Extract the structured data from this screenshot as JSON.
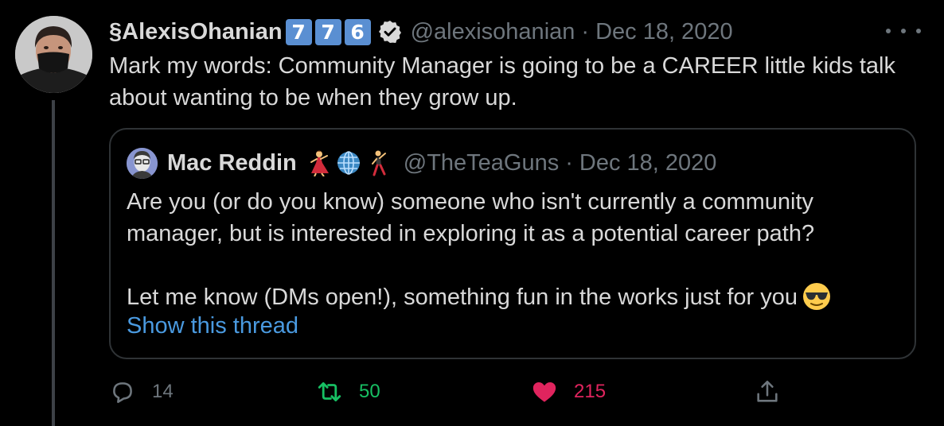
{
  "author": {
    "display_name": "§AlexisOhanian",
    "badges": [
      "7",
      "7",
      "6"
    ],
    "handle": "@alexisohanian",
    "separator": "·",
    "date": "Dec 18, 2020"
  },
  "tweet": {
    "text": "Mark my words: Community Manager is going to be a CAREER little kids talk about wanting to be when they grow up."
  },
  "quote": {
    "display_name": "Mac Reddin",
    "name_emojis": [
      "dancer-emoji",
      "globe-emoji",
      "man-dancing-emoji"
    ],
    "handle": "@TheTeaGuns",
    "separator": "·",
    "date": "Dec 18, 2020",
    "paragraph1": "Are you (or do you know) someone who isn't currently a community manager, but is interested in exploring it as a potential career path?",
    "paragraph2": "Let me know (DMs open!), something fun in the works just for you",
    "show_thread": "Show this thread"
  },
  "actions": {
    "reply_count": "14",
    "retweet_count": "50",
    "like_count": "215"
  },
  "colors": {
    "background": "#000000",
    "text": "#d9d9d9",
    "muted": "#6e767d",
    "link": "#4a9ae0",
    "retweet": "#17bf63",
    "like": "#e0245e",
    "badge": "#5a8fd2"
  }
}
